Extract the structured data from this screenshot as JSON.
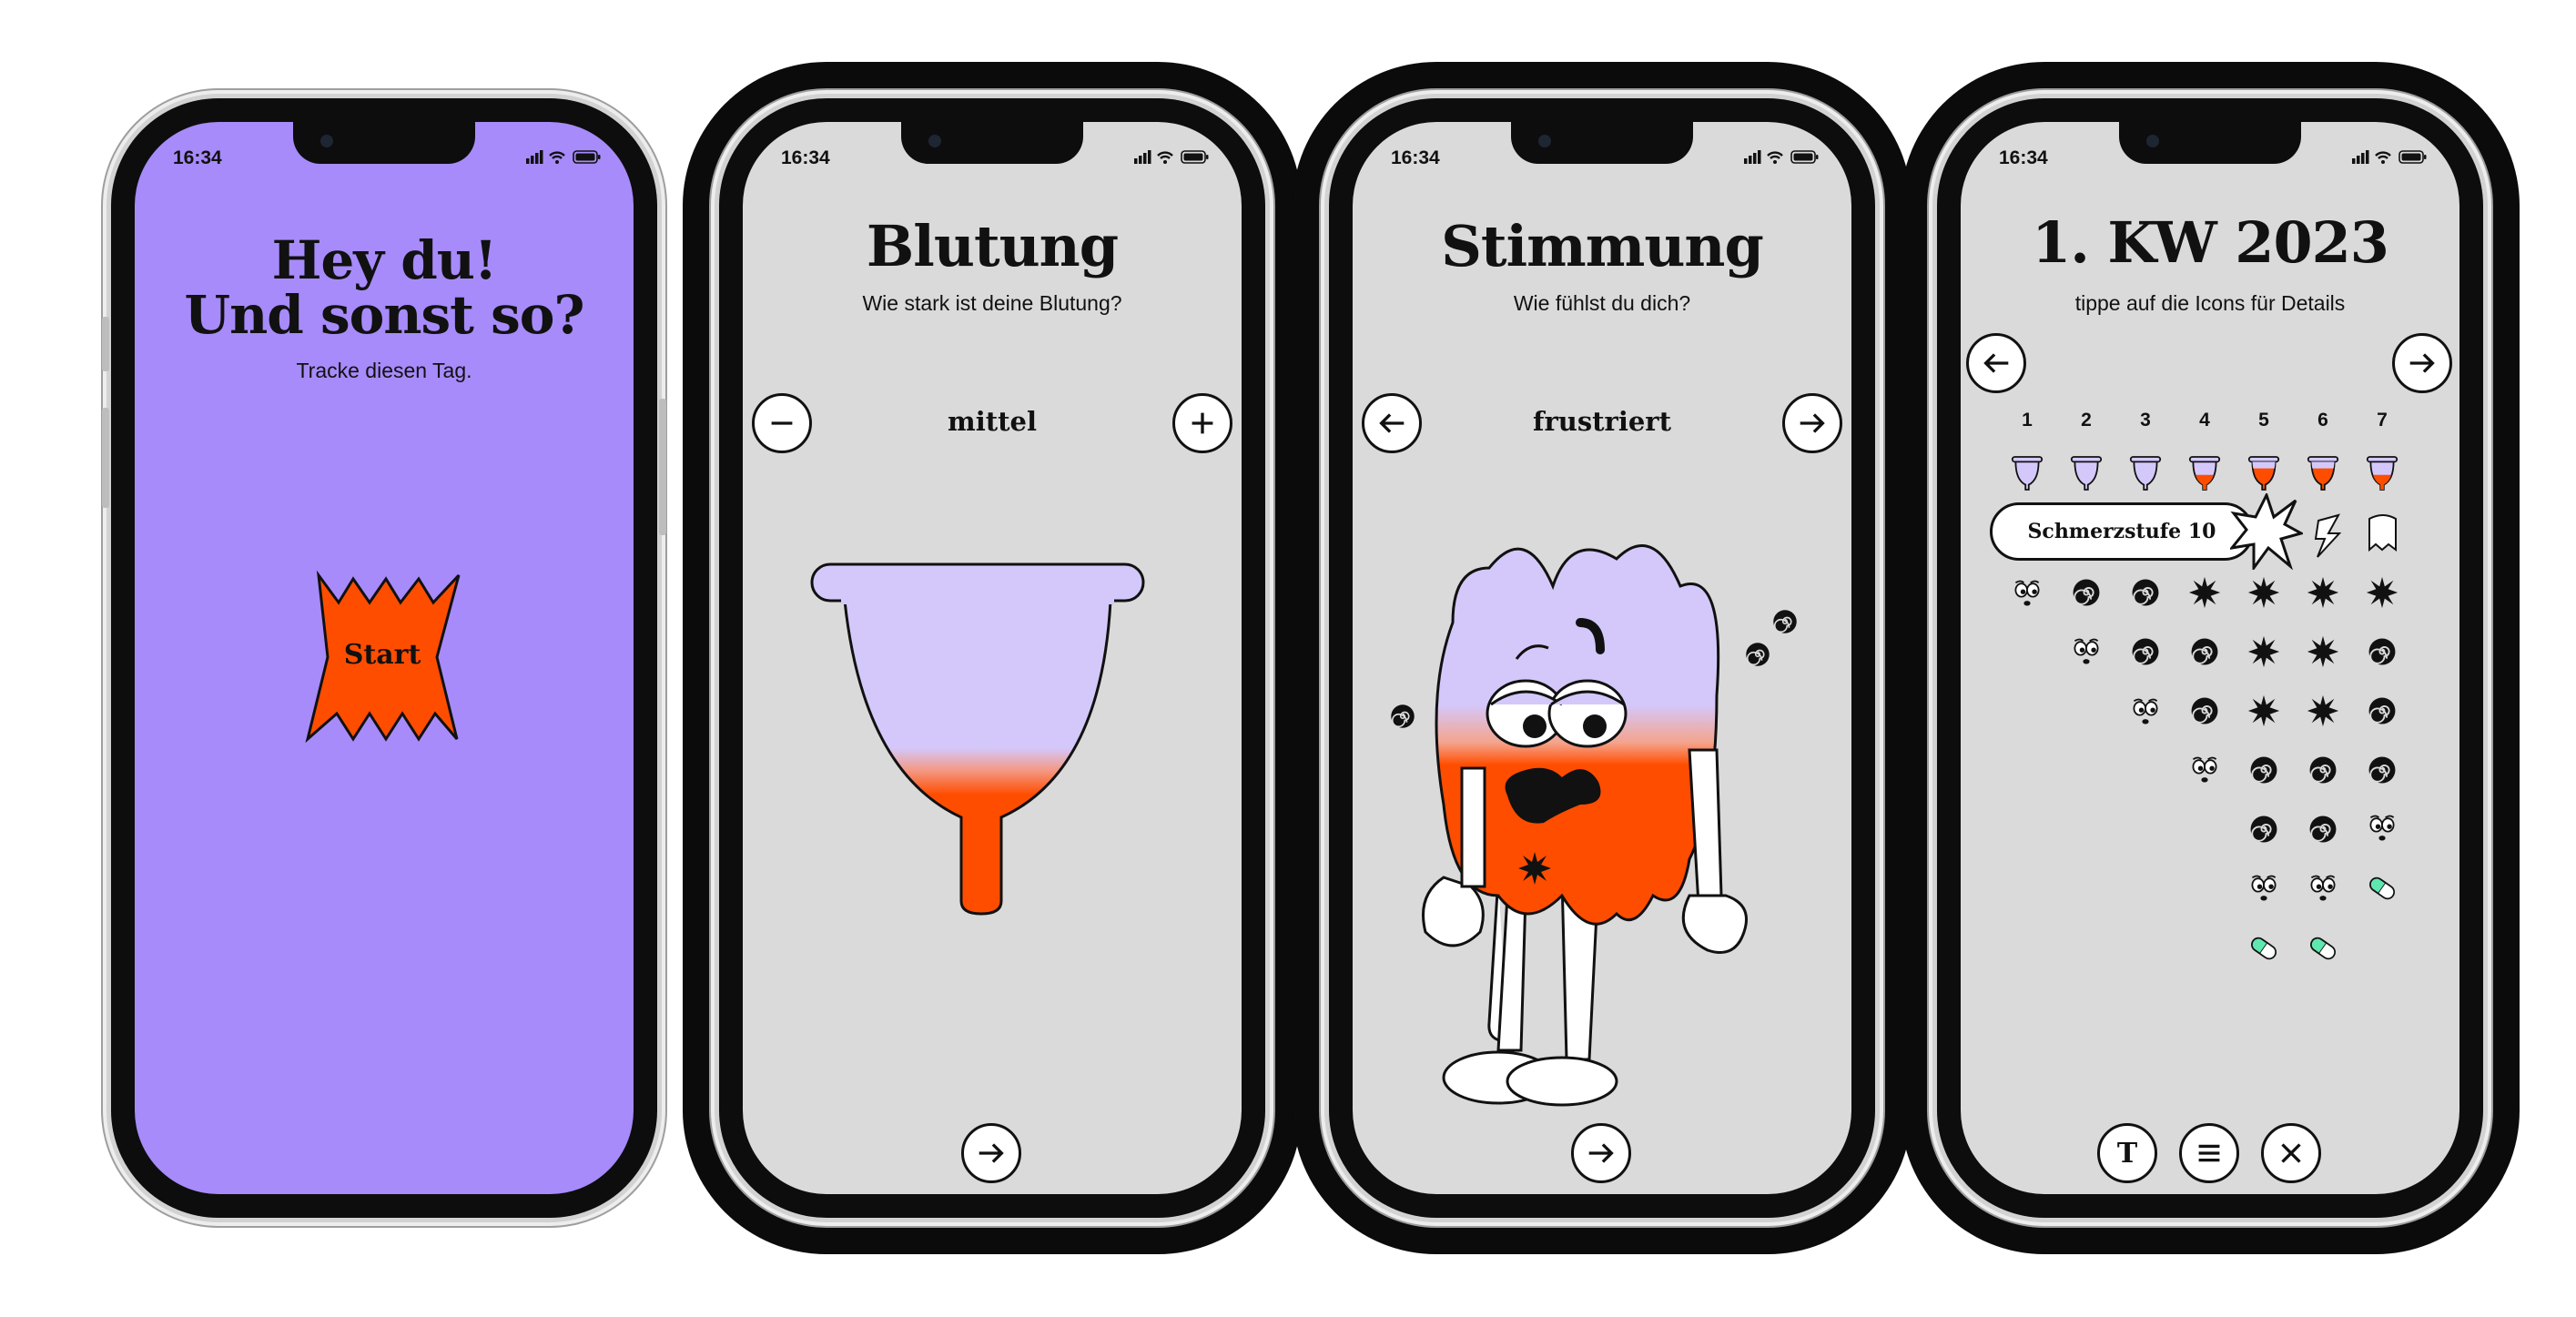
{
  "status_time": "16:34",
  "screen1": {
    "title_line1": "Hey du!",
    "title_line2": "Und sonst so?",
    "subtitle": "Tracke diesen Tag.",
    "start_label": "Start",
    "accent": "#ff4d00",
    "background": "#a78bfa"
  },
  "screen2": {
    "title": "Blutung",
    "subtitle": "Wie stark ist deine Blutung?",
    "value": "mittel"
  },
  "screen3": {
    "title": "Stimmung",
    "subtitle": "Wie fühlst du dich?",
    "value": "frustriert"
  },
  "screen4": {
    "title": "1. KW 2023",
    "subtitle": "tippe auf die Icons für Details",
    "days": [
      "1",
      "2",
      "3",
      "4",
      "5",
      "6",
      "7"
    ],
    "pain_label": "Schmerzstufe 10",
    "toolbar_text_icon": "T"
  },
  "icons": {
    "plus": "plus-icon",
    "minus": "minus-icon",
    "next": "arrow-right-icon",
    "prev": "arrow-left-icon",
    "menu": "menu-icon",
    "close": "close-icon"
  },
  "colors": {
    "lilac": "#d4c8fb",
    "blood": "#ff4d00",
    "pill": "#5ee8b0"
  }
}
